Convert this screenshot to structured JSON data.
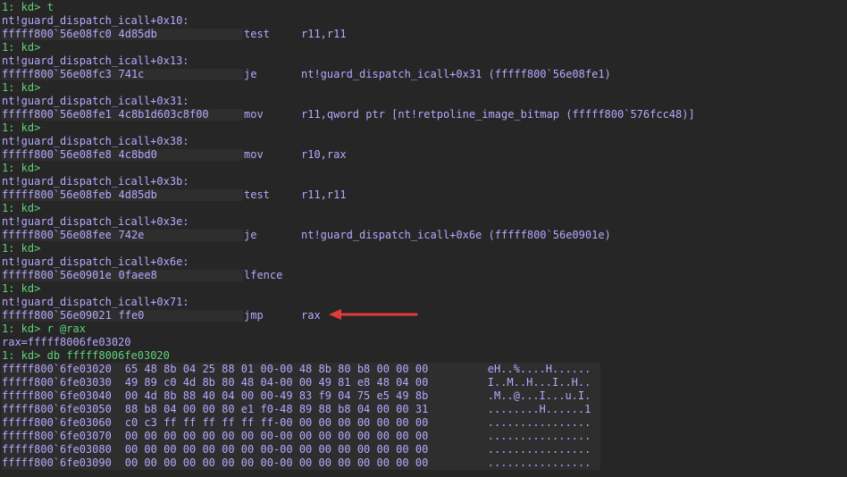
{
  "colors": {
    "background": "#262626",
    "prompt": "#5fd37a",
    "text": "#b8a8ff",
    "arrow": "#e23b3b"
  },
  "console": {
    "lines": [
      {
        "kind": "prompt",
        "prompt": "1: kd>",
        "command": "t"
      },
      {
        "kind": "symbol",
        "text": "nt!guard_dispatch_icall+0x10:"
      },
      {
        "kind": "asm",
        "address": "fffff800`56e08fc0",
        "bytes": "4d85db",
        "mnemonic": "test",
        "operands": "r11,r11"
      },
      {
        "kind": "prompt",
        "prompt": "1: kd>",
        "command": ""
      },
      {
        "kind": "symbol",
        "text": "nt!guard_dispatch_icall+0x13:"
      },
      {
        "kind": "asm",
        "address": "fffff800`56e08fc3",
        "bytes": "741c",
        "mnemonic": "je",
        "operands": "nt!guard_dispatch_icall+0x31 (fffff800`56e08fe1)"
      },
      {
        "kind": "prompt",
        "prompt": "1: kd>",
        "command": ""
      },
      {
        "kind": "symbol",
        "text": "nt!guard_dispatch_icall+0x31:"
      },
      {
        "kind": "asm",
        "address": "fffff800`56e08fe1",
        "bytes": "4c8b1d603c8f00",
        "mnemonic": "mov",
        "operands": "r11,qword ptr [nt!retpoline_image_bitmap (fffff800`576fcc48)]"
      },
      {
        "kind": "prompt",
        "prompt": "1: kd>",
        "command": ""
      },
      {
        "kind": "symbol",
        "text": "nt!guard_dispatch_icall+0x38:"
      },
      {
        "kind": "asm",
        "address": "fffff800`56e08fe8",
        "bytes": "4c8bd0",
        "mnemonic": "mov",
        "operands": "r10,rax"
      },
      {
        "kind": "prompt",
        "prompt": "1: kd>",
        "command": ""
      },
      {
        "kind": "symbol",
        "text": "nt!guard_dispatch_icall+0x3b:"
      },
      {
        "kind": "asm",
        "address": "fffff800`56e08feb",
        "bytes": "4d85db",
        "mnemonic": "test",
        "operands": "r11,r11"
      },
      {
        "kind": "prompt",
        "prompt": "1: kd>",
        "command": ""
      },
      {
        "kind": "symbol",
        "text": "nt!guard_dispatch_icall+0x3e:"
      },
      {
        "kind": "asm",
        "address": "fffff800`56e08fee",
        "bytes": "742e",
        "mnemonic": "je",
        "operands": "nt!guard_dispatch_icall+0x6e (fffff800`56e0901e)"
      },
      {
        "kind": "prompt",
        "prompt": "1: kd>",
        "command": ""
      },
      {
        "kind": "symbol",
        "text": "nt!guard_dispatch_icall+0x6e:"
      },
      {
        "kind": "asm",
        "address": "fffff800`56e0901e",
        "bytes": "0faee8",
        "mnemonic": "lfence",
        "operands": ""
      },
      {
        "kind": "prompt",
        "prompt": "1: kd>",
        "command": ""
      },
      {
        "kind": "symbol",
        "text": "nt!guard_dispatch_icall+0x71:"
      },
      {
        "kind": "asm",
        "address": "fffff800`56e09021",
        "bytes": "ffe0",
        "mnemonic": "jmp",
        "operands": "rax",
        "highlight": true
      },
      {
        "kind": "prompt",
        "prompt": "1: kd>",
        "command": "r @rax"
      },
      {
        "kind": "output",
        "text": "rax=fffff8006fe03020"
      },
      {
        "kind": "prompt",
        "prompt": "1: kd>",
        "command": "db fffff8006fe03020"
      },
      {
        "kind": "dump",
        "address": "fffff800`6fe03020",
        "hex": "65 48 8b 04 25 88 01 00-00 48 8b 80 b8 00 00 00",
        "ascii": "eH..%....H......"
      },
      {
        "kind": "dump",
        "address": "fffff800`6fe03030",
        "hex": "49 89 c0 4d 8b 80 48 04-00 00 49 81 e8 48 04 00",
        "ascii": "I..M..H...I..H.."
      },
      {
        "kind": "dump",
        "address": "fffff800`6fe03040",
        "hex": "00 4d 8b 88 40 04 00 00-49 83 f9 04 75 e5 49 8b",
        "ascii": ".M..@...I...u.I."
      },
      {
        "kind": "dump",
        "address": "fffff800`6fe03050",
        "hex": "88 b8 04 00 00 80 e1 f0-48 89 88 b8 04 00 00 31",
        "ascii": "........H......1"
      },
      {
        "kind": "dump",
        "address": "fffff800`6fe03060",
        "hex": "c0 c3 ff ff ff ff ff ff-00 00 00 00 00 00 00 00",
        "ascii": "................"
      },
      {
        "kind": "dump",
        "address": "fffff800`6fe03070",
        "hex": "00 00 00 00 00 00 00 00-00 00 00 00 00 00 00 00",
        "ascii": "................"
      },
      {
        "kind": "dump",
        "address": "fffff800`6fe03080",
        "hex": "00 00 00 00 00 00 00 00-00 00 00 00 00 00 00 00",
        "ascii": "................"
      },
      {
        "kind": "dump",
        "address": "fffff800`6fe03090",
        "hex": "00 00 00 00 00 00 00 00-00 00 00 00 00 00 00 00",
        "ascii": "................"
      }
    ]
  }
}
